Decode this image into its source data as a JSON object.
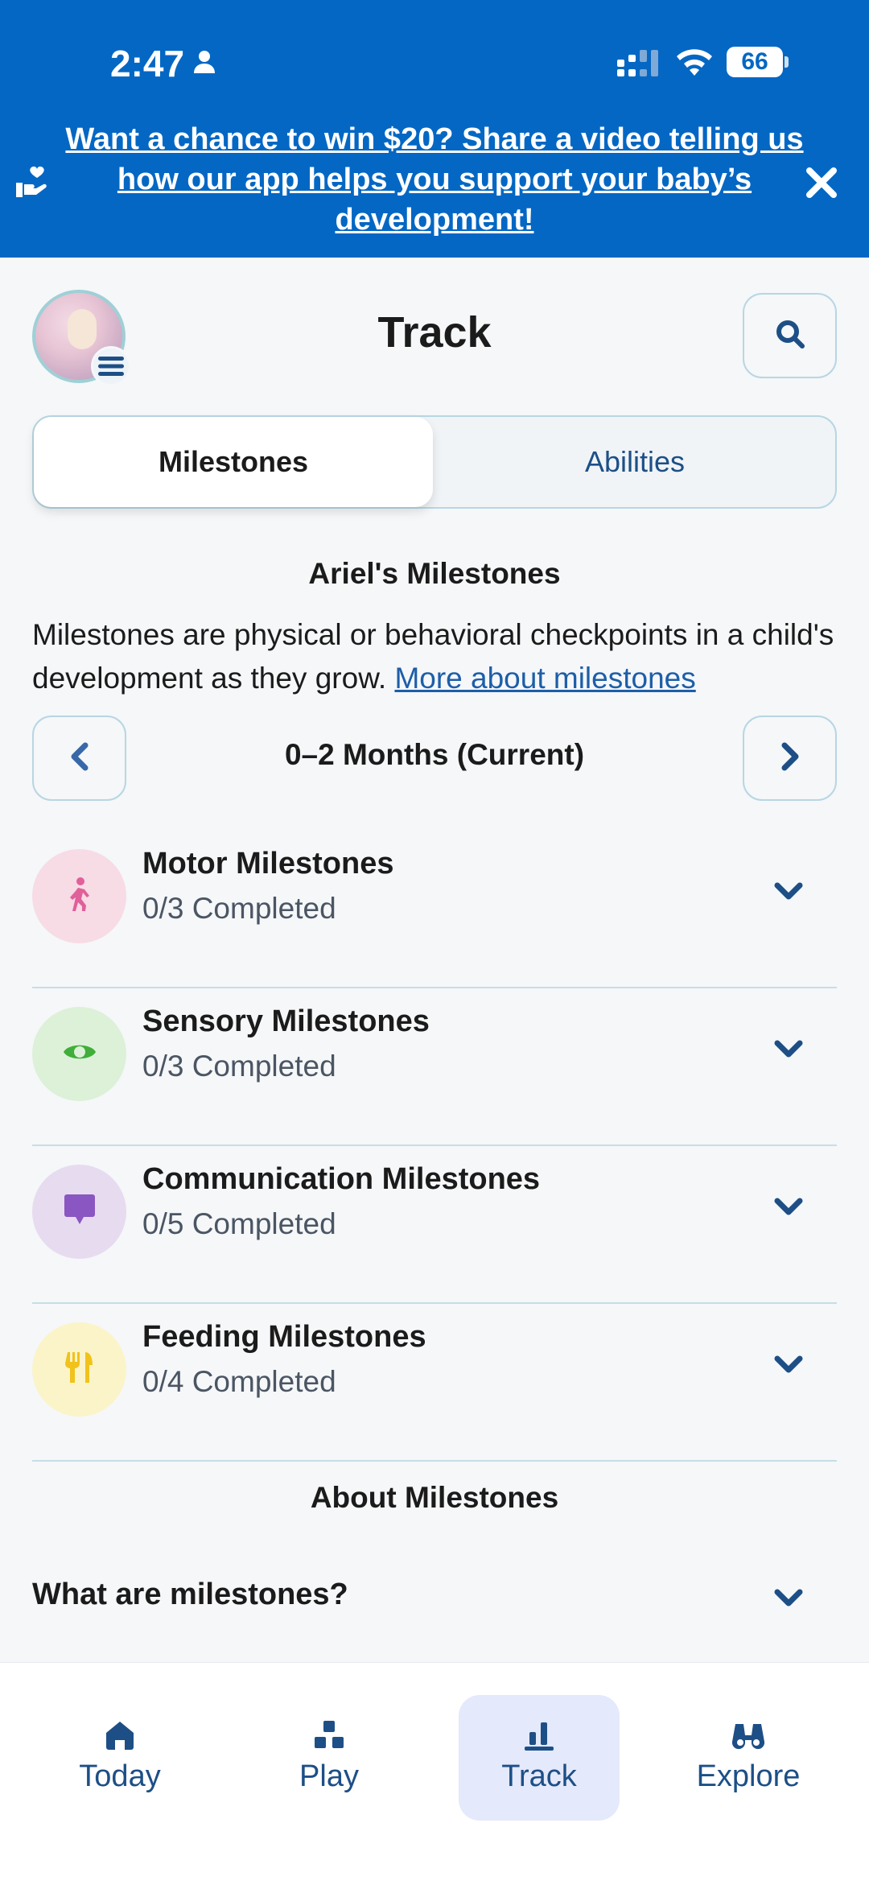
{
  "status_bar": {
    "time": "2:47",
    "battery": "66"
  },
  "promo": {
    "text": "Want a chance to win $20? Share a video telling us how our app helps you support your baby’s development!"
  },
  "header": {
    "title": "Track"
  },
  "segmented": {
    "tabs": [
      "Milestones",
      "Abilities"
    ],
    "selected": "Milestones"
  },
  "section": {
    "title": "Ariel's Milestones",
    "description": "Milestones are physical or behavioral checkpoints in a child's development as they grow. ",
    "link": "More about milestones"
  },
  "range": {
    "label": "0–2 Months (Current)"
  },
  "milestones": [
    {
      "title": "Motor Milestones",
      "sub": "0/3 Completed",
      "icon": "walking-person-icon",
      "color": "#f7dbe5",
      "fg": "#e0609a"
    },
    {
      "title": "Sensory Milestones",
      "sub": "0/3 Completed",
      "icon": "eye-icon",
      "color": "#dcf1d8",
      "fg": "#3fae3a"
    },
    {
      "title": "Communication Milestones",
      "sub": "0/5 Completed",
      "icon": "speech-bubble-icon",
      "color": "#e7dbf0",
      "fg": "#8a56c2"
    },
    {
      "title": "Feeding Milestones",
      "sub": "0/4 Completed",
      "icon": "fork-knife-icon",
      "color": "#fbf4c8",
      "fg": "#f0c21b"
    }
  ],
  "about": {
    "title": "About Milestones",
    "faq": "What are milestones?"
  },
  "tabbar": {
    "items": [
      {
        "label": "Today",
        "icon": "home-icon"
      },
      {
        "label": "Play",
        "icon": "blocks-icon"
      },
      {
        "label": "Track",
        "icon": "chart-icon"
      },
      {
        "label": "Explore",
        "icon": "binoculars-icon"
      }
    ],
    "active": "Track"
  },
  "colors": {
    "brand_blue": "#0467c4",
    "navy": "#1d4f86",
    "link": "#1d5ea8"
  }
}
